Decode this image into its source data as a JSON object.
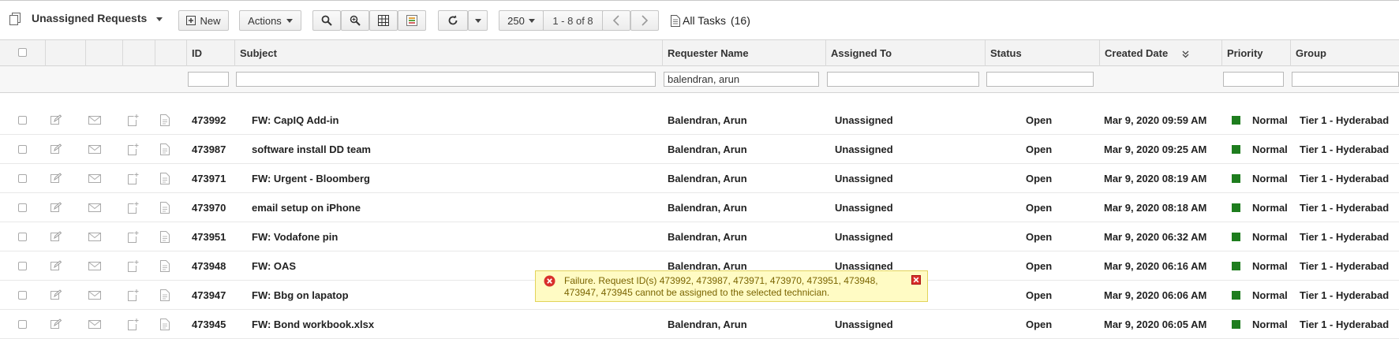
{
  "toolbar": {
    "view_title": "Unassigned Requests",
    "new_label": "New",
    "actions_label": "Actions",
    "page_size": "250",
    "page_range": "1 - 8 of 8",
    "all_tasks": "All Tasks",
    "tasks_count": "(16)"
  },
  "columns": {
    "id": "ID",
    "subject": "Subject",
    "requester": "Requester Name",
    "assigned": "Assigned To",
    "status": "Status",
    "created": "Created Date",
    "priority": "Priority",
    "group": "Group"
  },
  "filters": {
    "requester_value": "balendran, arun"
  },
  "rows": [
    {
      "id": "473992",
      "subject": "FW: CapIQ Add-in",
      "requester": "Balendran, Arun",
      "assigned": "Unassigned",
      "status": "Open",
      "created": "Mar 9, 2020 09:59 AM",
      "priority": "Normal",
      "group": "Tier 1 - Hyderabad"
    },
    {
      "id": "473987",
      "subject": "software install DD team",
      "requester": "Balendran, Arun",
      "assigned": "Unassigned",
      "status": "Open",
      "created": "Mar 9, 2020 09:25 AM",
      "priority": "Normal",
      "group": "Tier 1 - Hyderabad"
    },
    {
      "id": "473971",
      "subject": "FW: Urgent - Bloomberg",
      "requester": "Balendran, Arun",
      "assigned": "Unassigned",
      "status": "Open",
      "created": "Mar 9, 2020 08:19 AM",
      "priority": "Normal",
      "group": "Tier 1 - Hyderabad"
    },
    {
      "id": "473970",
      "subject": "email setup on iPhone",
      "requester": "Balendran, Arun",
      "assigned": "Unassigned",
      "status": "Open",
      "created": "Mar 9, 2020 08:18 AM",
      "priority": "Normal",
      "group": "Tier 1 - Hyderabad"
    },
    {
      "id": "473951",
      "subject": "FW: Vodafone pin",
      "requester": "Balendran, Arun",
      "assigned": "Unassigned",
      "status": "Open",
      "created": "Mar 9, 2020 06:32 AM",
      "priority": "Normal",
      "group": "Tier 1 - Hyderabad"
    },
    {
      "id": "473948",
      "subject": "FW: OAS",
      "requester": "Balendran, Arun",
      "assigned": "Unassigned",
      "status": "Open",
      "created": "Mar 9, 2020 06:16 AM",
      "priority": "Normal",
      "group": "Tier 1 - Hyderabad"
    },
    {
      "id": "473947",
      "subject": "FW: Bbg on lapatop",
      "requester": "",
      "assigned": "",
      "status": "Open",
      "created": "Mar 9, 2020 06:06 AM",
      "priority": "Normal",
      "group": "Tier 1 - Hyderabad"
    },
    {
      "id": "473945",
      "subject": "FW: Bond workbook.xlsx",
      "requester": "Balendran, Arun",
      "assigned": "Unassigned",
      "status": "Open",
      "created": "Mar 9, 2020 06:05 AM",
      "priority": "Normal",
      "group": "Tier 1 - Hyderabad"
    }
  ],
  "toast": {
    "message": "Failure. Request ID(s) 473992, 473987, 473971, 473970, 473951, 473948, 473947, 473945 cannot be assigned to the selected technician."
  },
  "colors": {
    "priority_normal": "#1e7d1e",
    "error_red": "#d9302c",
    "toast_bg": "#fffbc4"
  },
  "icons": {
    "view": "view-list-icon",
    "new": "plus-box-icon",
    "search": "search-icon",
    "advanced_search": "advanced-search-icon",
    "columns": "grid-columns-icon",
    "legend": "color-legend-icon",
    "refresh": "refresh-icon",
    "prev": "chevron-left-icon",
    "next": "chevron-right-icon",
    "tasks": "task-document-icon",
    "sort": "sort-descending-icon",
    "edit": "edit-icon",
    "mail": "mail-icon",
    "add_note": "add-note-icon",
    "notes": "notes-icon",
    "error": "error-icon",
    "close": "close-icon"
  }
}
